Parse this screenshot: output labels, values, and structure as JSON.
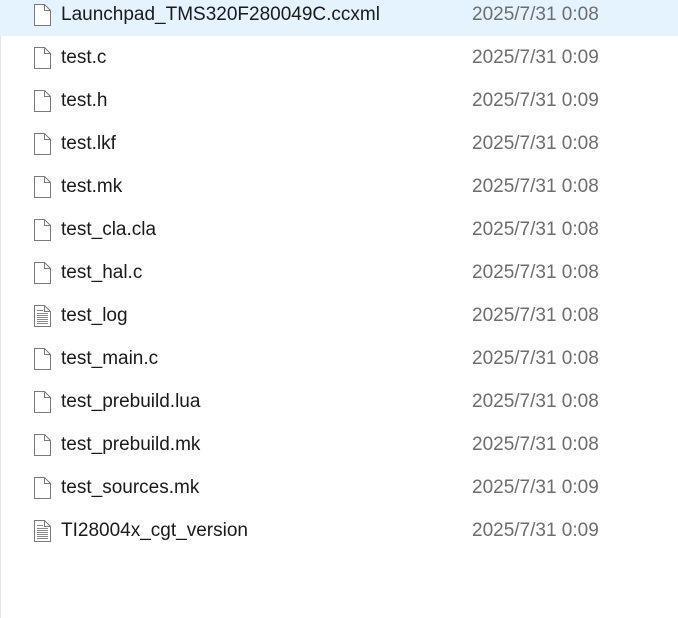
{
  "files": [
    {
      "name": "Launchpad_TMS320F280049C.ccxml",
      "modified": "2025/7/31 0:08",
      "icon": "blank-file-icon"
    },
    {
      "name": "test.c",
      "modified": "2025/7/31 0:09",
      "icon": "blank-file-icon"
    },
    {
      "name": "test.h",
      "modified": "2025/7/31 0:09",
      "icon": "blank-file-icon"
    },
    {
      "name": "test.lkf",
      "modified": "2025/7/31 0:08",
      "icon": "blank-file-icon"
    },
    {
      "name": "test.mk",
      "modified": "2025/7/31 0:08",
      "icon": "blank-file-icon"
    },
    {
      "name": "test_cla.cla",
      "modified": "2025/7/31 0:08",
      "icon": "blank-file-icon"
    },
    {
      "name": "test_hal.c",
      "modified": "2025/7/31 0:08",
      "icon": "blank-file-icon"
    },
    {
      "name": "test_log",
      "modified": "2025/7/31 0:08",
      "icon": "text-file-icon"
    },
    {
      "name": "test_main.c",
      "modified": "2025/7/31 0:08",
      "icon": "blank-file-icon"
    },
    {
      "name": "test_prebuild.lua",
      "modified": "2025/7/31 0:08",
      "icon": "blank-file-icon"
    },
    {
      "name": "test_prebuild.mk",
      "modified": "2025/7/31 0:08",
      "icon": "blank-file-icon"
    },
    {
      "name": "test_sources.mk",
      "modified": "2025/7/31 0:09",
      "icon": "blank-file-icon"
    },
    {
      "name": "TI28004x_cgt_version",
      "modified": "2025/7/31 0:09",
      "icon": "text-file-icon"
    }
  ]
}
